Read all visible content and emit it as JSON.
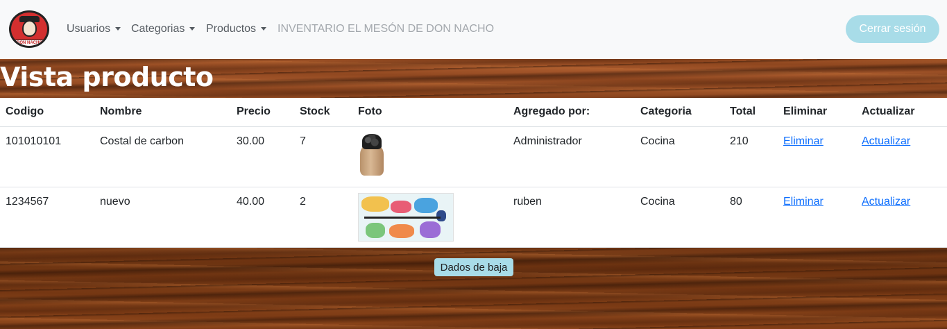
{
  "navbar": {
    "logo_alt": "Restaurante El Mesón de Don Nacho",
    "logo_text_bottom": "DON NACHO",
    "menu": [
      {
        "label": "Usuarios"
      },
      {
        "label": "Categorias"
      },
      {
        "label": "Productos"
      }
    ],
    "brand": "INVENTARIO EL MESÓN DE DON NACHO",
    "logout_label": "Cerrar sesión"
  },
  "page": {
    "title": "Vista producto"
  },
  "table": {
    "headers": [
      "Codigo",
      "Nombre",
      "Precio",
      "Stock",
      "Foto",
      "Agregado por:",
      "Categoria",
      "Total",
      "Eliminar",
      "Actualizar"
    ],
    "rows": [
      {
        "codigo": "101010101",
        "nombre": "Costal de carbon",
        "precio": "30.00",
        "stock": "7",
        "foto": "coal-sack-image",
        "agregado_por": "Administrador",
        "categoria": "Cocina",
        "total": "210",
        "eliminar": "Eliminar",
        "actualizar": "Actualizar"
      },
      {
        "codigo": "1234567",
        "nombre": "nuevo",
        "precio": "40.00",
        "stock": "2",
        "foto": "collage-image",
        "agregado_por": "ruben",
        "categoria": "Cocina",
        "total": "80",
        "eliminar": "Eliminar",
        "actualizar": "Actualizar"
      }
    ]
  },
  "footer": {
    "button_label": "Dados de baja"
  },
  "colors": {
    "navbar_bg": "#f8f9fa",
    "button_bg": "#a8dce8",
    "link": "#0d6efd",
    "logo_red": "#d32f2f"
  }
}
